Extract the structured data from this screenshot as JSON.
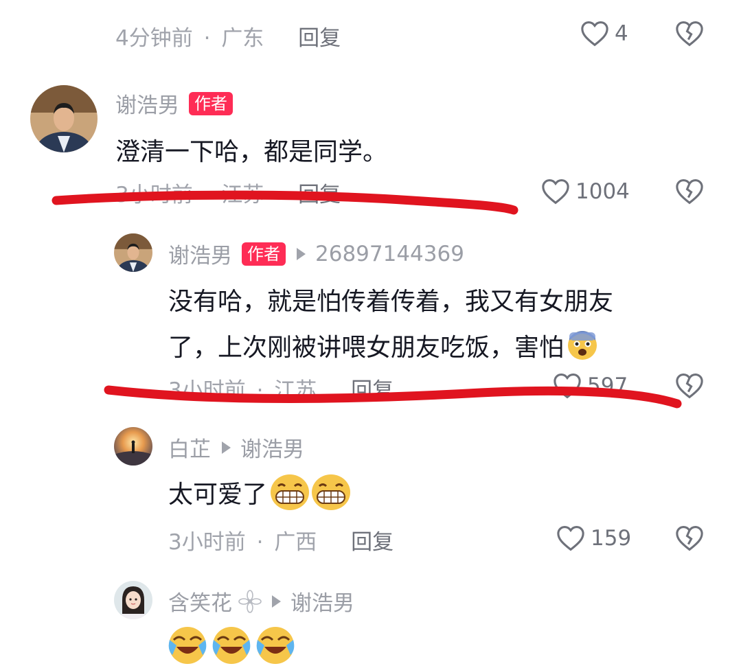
{
  "comments": [
    {
      "meta_time": "4分钟前",
      "meta_sep": "·",
      "meta_location": "广东",
      "reply_label": "回复",
      "likes": "4"
    },
    {
      "username": "谢浩男",
      "badge": "作者",
      "text": "澄清一下哈，都是同学。",
      "meta_time": "3小时前",
      "meta_sep": "·",
      "meta_location": "江苏",
      "reply_label": "回复",
      "likes": "1004"
    },
    {
      "username": "谢浩男",
      "badge": "作者",
      "reply_to": "26897144369",
      "text_line1": "没有哈，就是怕传着传着，我又有女朋友",
      "text_line2": "了，上次刚被讲喂女朋友吃饭，害怕",
      "meta_time": "3小时前",
      "meta_sep": "·",
      "meta_location": "江苏",
      "reply_label": "回复",
      "likes": "597"
    },
    {
      "username": "白芷",
      "reply_to": "谢浩男",
      "text": "太可爱了",
      "meta_time": "3小时前",
      "meta_sep": "·",
      "meta_location": "广西",
      "reply_label": "回复",
      "likes": "159"
    },
    {
      "username": "含笑花",
      "reply_to": "谢浩男"
    }
  ],
  "colors": {
    "badge": "#fe2c55",
    "annotation_red": "#e0141f",
    "muted_text": "#a0a3ab"
  },
  "icons": [
    "heart-outline-icon",
    "broken-heart-icon",
    "play-triangle-icon",
    "grin-emoji",
    "fearful-emoji",
    "crying-laughing-emoji",
    "flower-icon"
  ]
}
